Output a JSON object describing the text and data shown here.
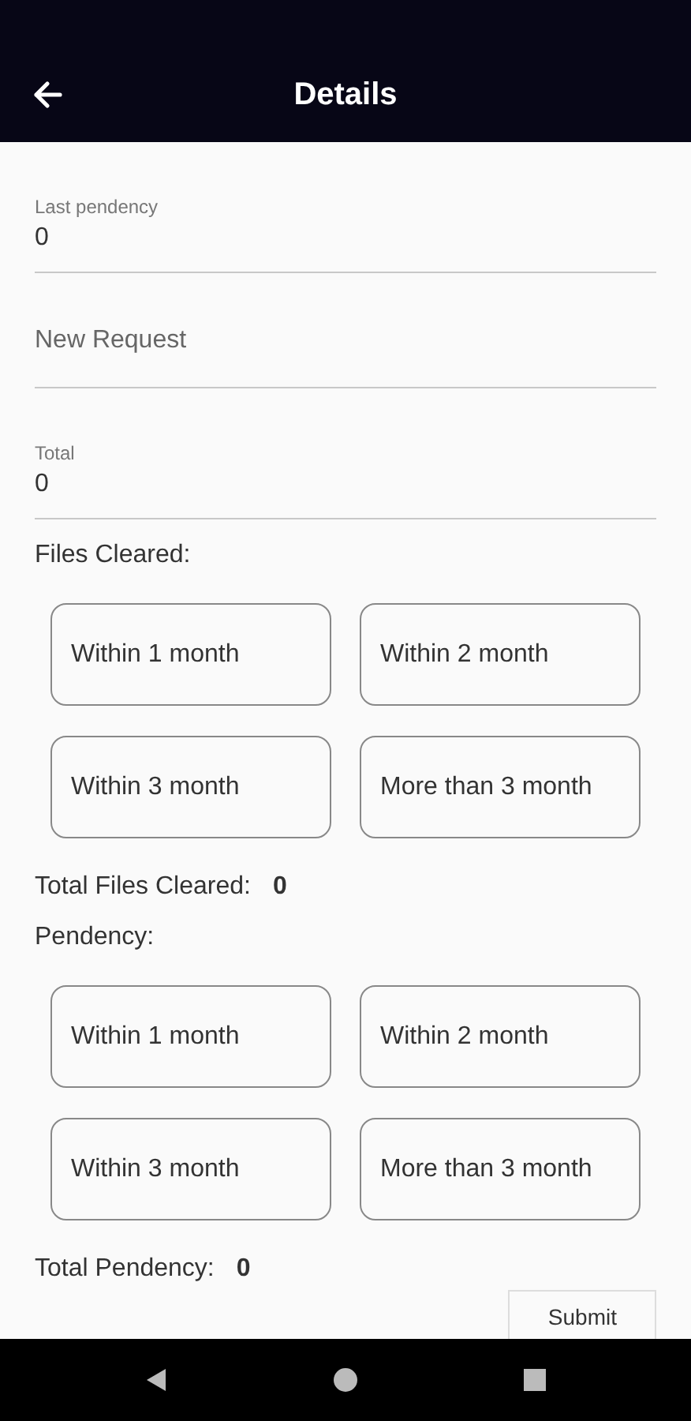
{
  "app_bar": {
    "title": "Details"
  },
  "fields": [
    {
      "label": "Last pendency",
      "value": "0"
    },
    {
      "placeholder": "New Request"
    },
    {
      "label": "Total",
      "value": "0"
    }
  ],
  "sections": [
    {
      "title": "Files Cleared:",
      "options": [
        "Within 1 month",
        "Within 2 month",
        "Within 3 month",
        "More than 3 month"
      ],
      "total_label": "Total Files Cleared:",
      "total_value": "0"
    },
    {
      "title": "Pendency:",
      "options": [
        "Within 1 month",
        "Within 2 month",
        "Within 3 month",
        "More than 3 month"
      ],
      "total_label": "Total Pendency:",
      "total_value": "0"
    }
  ],
  "submit_button": "Submit"
}
